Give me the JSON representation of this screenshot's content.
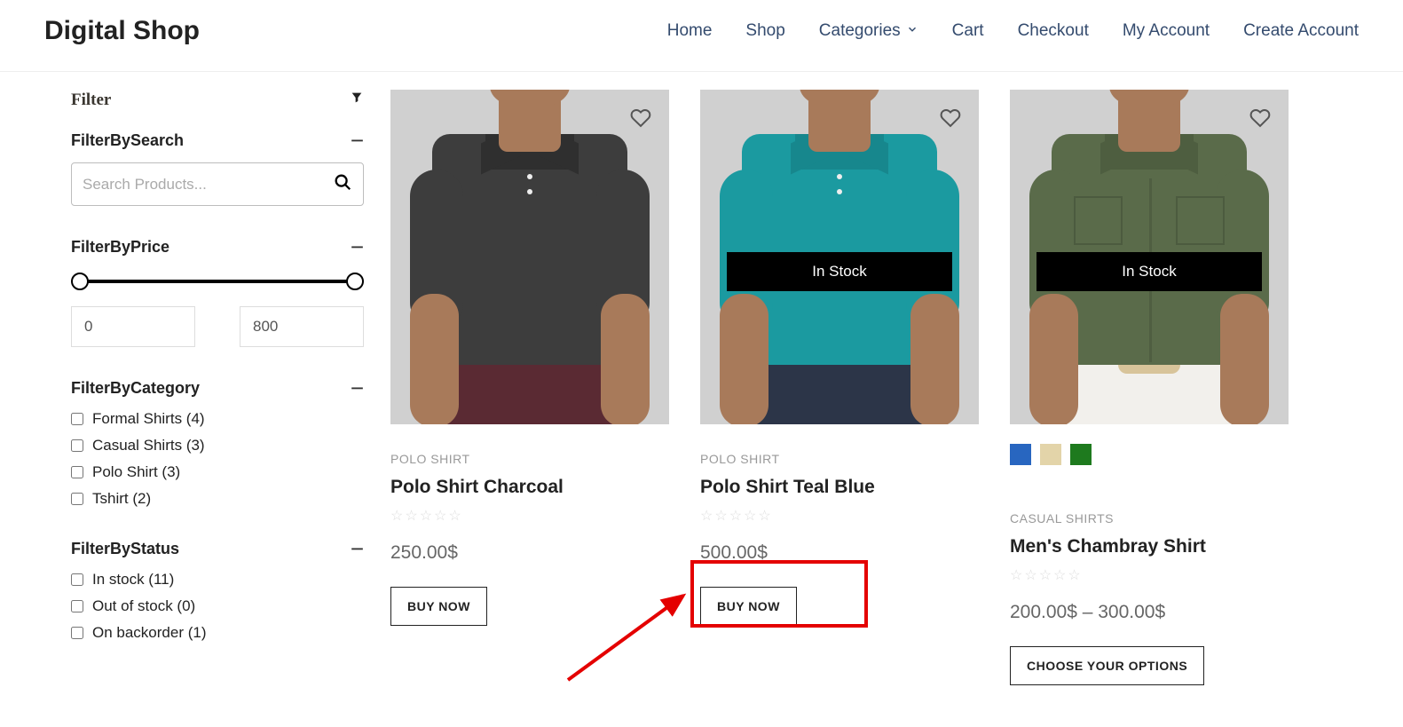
{
  "header": {
    "logo": "Digital Shop",
    "nav": {
      "home": "Home",
      "shop": "Shop",
      "categories": "Categories",
      "cart": "Cart",
      "checkout": "Checkout",
      "account": "My Account",
      "create": "Create Account"
    }
  },
  "sidebar": {
    "filter_label": "Filter",
    "search": {
      "title": "FilterBySearch",
      "placeholder": "Search Products..."
    },
    "price": {
      "title": "FilterByPrice",
      "min": "0",
      "max": "800"
    },
    "category": {
      "title": "FilterByCategory",
      "items": [
        {
          "label": "Formal Shirts (4)"
        },
        {
          "label": "Casual Shirts (3)"
        },
        {
          "label": "Polo Shirt (3)"
        },
        {
          "label": "Tshirt (2)"
        }
      ]
    },
    "status": {
      "title": "FilterByStatus",
      "items": [
        {
          "label": "In stock (11)"
        },
        {
          "label": "Out of stock (0)"
        },
        {
          "label": "On backorder (1)"
        }
      ]
    }
  },
  "products": [
    {
      "category": "POLO SHIRT",
      "title": "Polo Shirt Charcoal",
      "price": "250.00$",
      "cta": "BUY NOW",
      "stock": null,
      "shirt": "#3d3d3d",
      "collar": "#2f2f2f",
      "pants": "#5a2a33",
      "swatches": []
    },
    {
      "category": "POLO SHIRT",
      "title": "Polo Shirt Teal Blue",
      "price": "500.00$",
      "cta": "BUY NOW",
      "stock": "In Stock",
      "shirt": "#1b9aa0",
      "collar": "#17878d",
      "pants": "#2c3548",
      "swatches": []
    },
    {
      "category": "CASUAL SHIRTS",
      "title": "Men's Chambray Shirt",
      "price": "200.00$ – 300.00$",
      "cta": "CHOOSE YOUR OPTIONS",
      "stock": "In Stock",
      "shirt": "#5a6b4a",
      "collar": "#4e5e40",
      "pants": "#f2f0ec",
      "undershirt": "#d8c49a",
      "swatches": [
        "#2866c0",
        "#e3d4a9",
        "#1e7a1e"
      ]
    }
  ]
}
